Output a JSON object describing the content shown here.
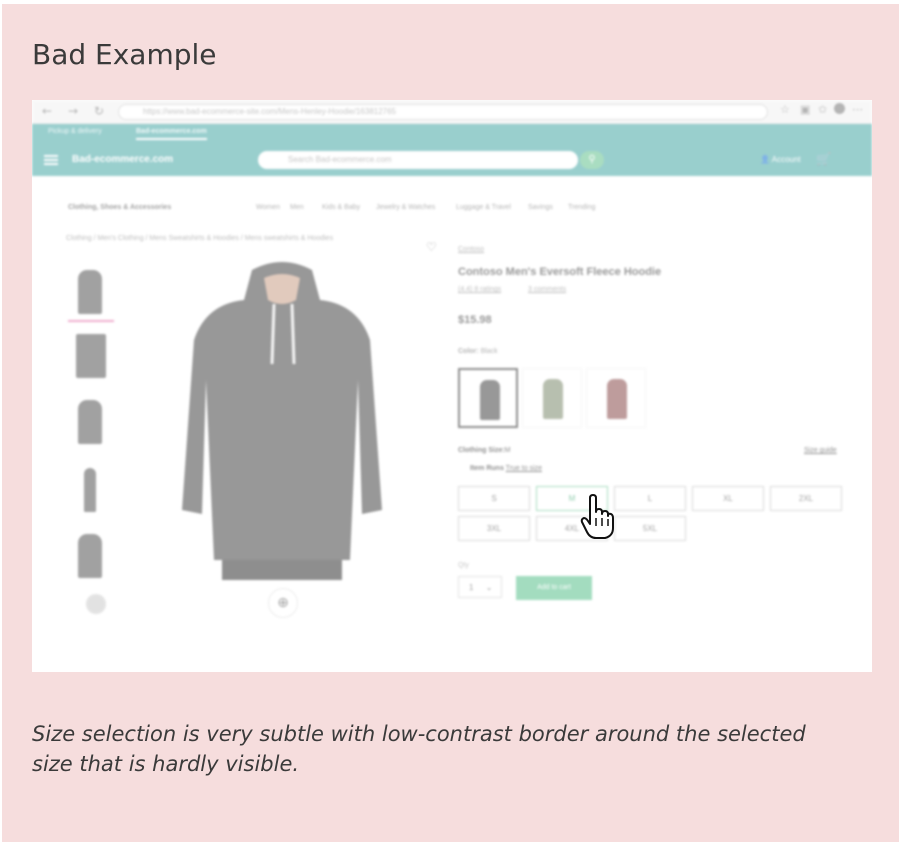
{
  "heading": "Bad Example",
  "caption": "Size selection is very subtle with low-contrast border around the selected size that is hardly visible.",
  "colors": {
    "card_bg": "#f6dddd",
    "header_teal": "#47a8a6",
    "accent_green": "#58c08c",
    "selected_tab_pink": "#e36aa5"
  },
  "screenshot": {
    "browser": {
      "url": "https://www.bad-ecommerce-site.com/Mens-Henley-Hoodie/163812765",
      "back_icon": "arrow-left-icon",
      "forward_icon": "arrow-right-icon",
      "reload_icon": "reload-icon"
    },
    "header": {
      "tabs": [
        "Pickup & delivery",
        "Bad-ecommerce.com"
      ],
      "brand": "Bad-ecommerce.com",
      "search_placeholder": "Search Bad-ecommerce.com",
      "account_label": "Account",
      "cart_icon": "cart-icon"
    },
    "category_nav": {
      "title": "Clothing, Shoes & Accessories",
      "items": [
        "Women",
        "Men",
        "Kids & Baby",
        "Jewelry & Watches",
        "Luggage & Travel",
        "Savings",
        "Trending"
      ]
    },
    "breadcrumb": "Clothing / Men's Clothing / Mens Sweatshirts & Hoodies / Mens sweatshirts & Hoodies",
    "product": {
      "brand": "Contoso",
      "title": "Contoso Men's Eversoft Fleece Hoodie",
      "rating_text": "(4.4) 8 ratings",
      "comments_text": "3 comments",
      "price": "$15.98",
      "color_label": "Color:",
      "color_value": "Black",
      "size_label": "Clothing Size:",
      "size_value": "M",
      "size_guide": "Size guide",
      "item_runs_label": "Item Runs",
      "item_runs_value": "True to size",
      "sizes": [
        "S",
        "M",
        "L",
        "XL",
        "2XL",
        "3XL",
        "4XL",
        "5XL"
      ],
      "selected_size": "M",
      "qty_label": "Qty",
      "qty_value": "1",
      "add_to_cart": "Add to cart"
    }
  }
}
